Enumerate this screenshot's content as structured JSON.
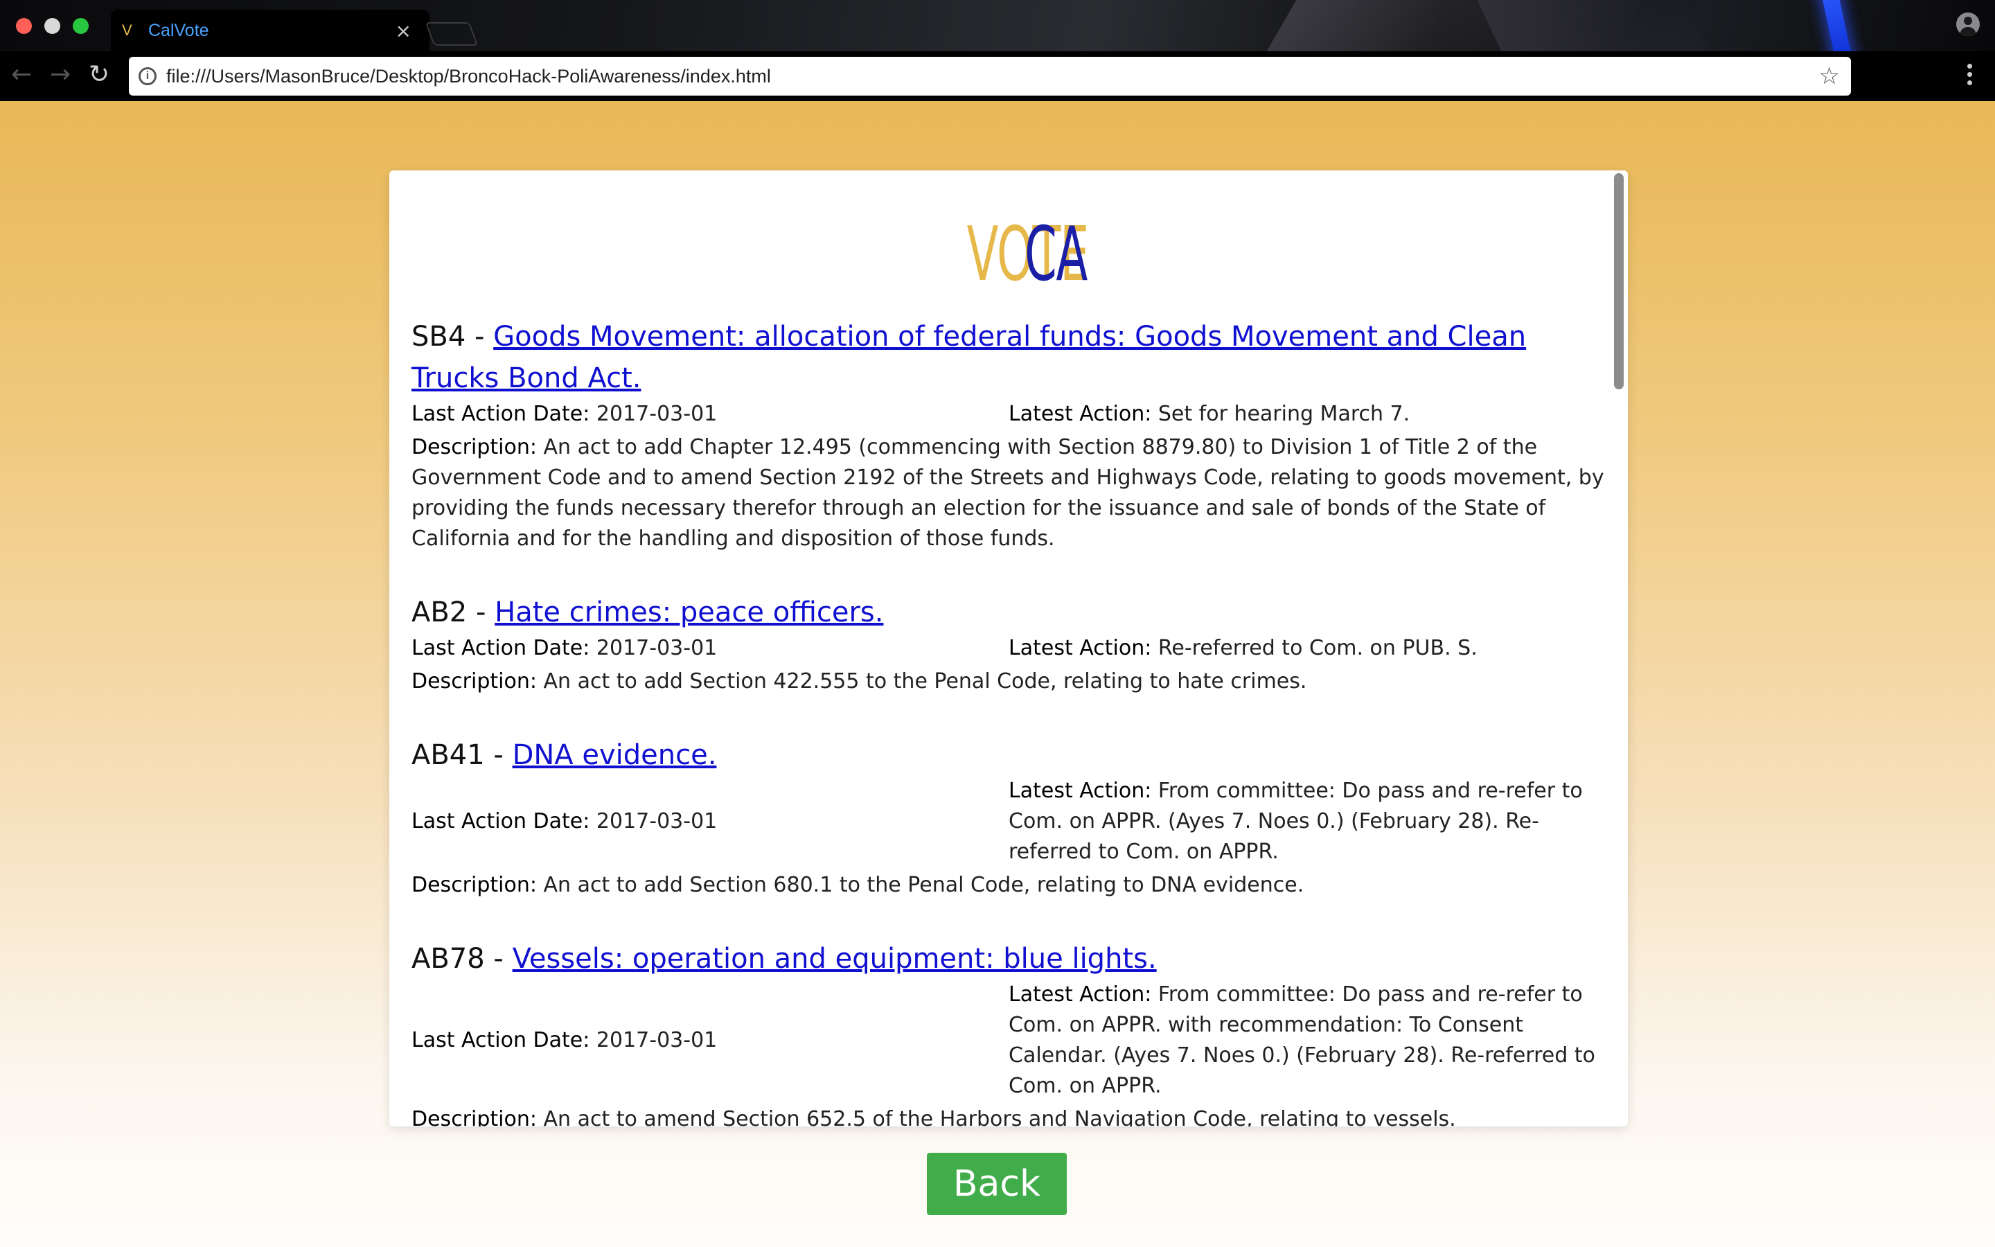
{
  "browser": {
    "tab": {
      "favicon": "V",
      "title": "CalVote",
      "close": "×"
    },
    "url": "file:///Users/MasonBruce/Desktop/BroncoHack-PoliAwareness/index.html"
  },
  "page": {
    "logo": {
      "part1": "VOTE",
      "part2": "CA",
      "colors": {
        "part1": "#e6b84a",
        "part2": "#1a1fa6"
      }
    },
    "labels": {
      "last_action_date": "Last Action Date:",
      "latest_action": "Latest Action:",
      "description": "Description:"
    },
    "bills": [
      {
        "id": "SB4",
        "title": "Goods Movement: allocation of federal funds: Goods Movement and Clean Trucks Bond Act.",
        "last_action_date": "2017-03-01",
        "latest_action": "Set for hearing March 7.",
        "description": "An act to add Chapter 12.495 (commencing with Section 8879.80) to Division 1 of Title 2 of the Government Code and to amend Section 2192 of the Streets and Highways Code, relating to goods movement, by providing the funds necessary therefor through an election for the issuance and sale of bonds of the State of California and for the handling and disposition of those funds."
      },
      {
        "id": "AB2",
        "title": "Hate crimes: peace officers.",
        "last_action_date": "2017-03-01",
        "latest_action": "Re-referred to Com. on PUB. S.",
        "description": "An act to add Section 422.555 to the Penal Code, relating to hate crimes."
      },
      {
        "id": "AB41",
        "title": "DNA evidence.",
        "last_action_date": "2017-03-01",
        "latest_action": "From committee: Do pass and re-refer to Com. on APPR. (Ayes 7. Noes 0.) (February 28). Re-referred to Com. on APPR.",
        "description": "An act to add Section 680.1 to the Penal Code, relating to DNA evidence."
      },
      {
        "id": "AB78",
        "title": "Vessels: operation and equipment: blue lights.",
        "last_action_date": "2017-03-01",
        "latest_action": "From committee: Do pass and re-refer to Com. on APPR. with recommendation: To Consent Calendar. (Ayes 7. Noes 0.) (February 28). Re-referred to Com. on APPR.",
        "description": "An act to amend Section 652.5 of the Harbors and Navigation Code, relating to vessels."
      }
    ],
    "back_button": "Back"
  }
}
